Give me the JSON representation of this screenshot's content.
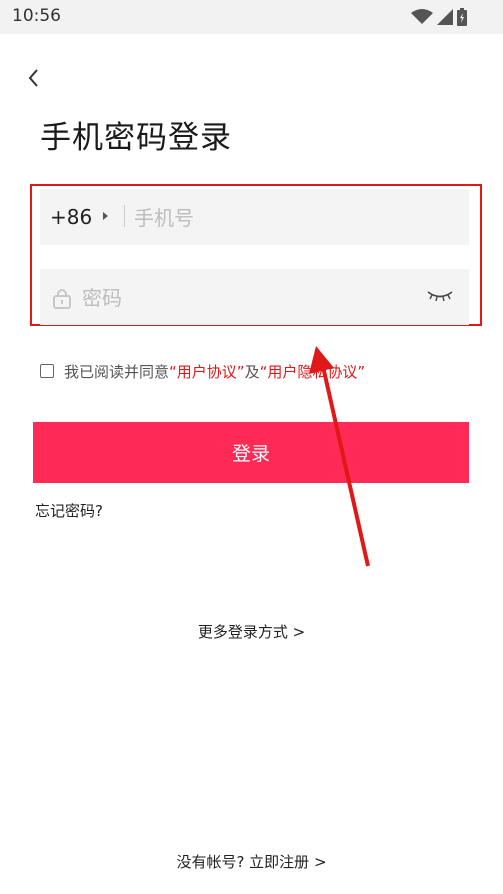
{
  "status_bar": {
    "time": "10:56"
  },
  "header": {
    "title": "手机密码登录"
  },
  "phone": {
    "country_code": "+86",
    "placeholder": "手机号"
  },
  "password": {
    "placeholder": "密码"
  },
  "agreement": {
    "prefix": "我已阅读并同意",
    "link1": "“用户协议”",
    "middle": "及",
    "link2": "“用户隐私协议”",
    "checked": false
  },
  "actions": {
    "login_label": "登录",
    "forgot_label": "忘记密码?",
    "more_login_label": "更多登录方式 >",
    "register_label": "没有帐号? 立即注册 >"
  },
  "colors": {
    "primary": "#ff2a55",
    "highlight": "#e01818"
  }
}
